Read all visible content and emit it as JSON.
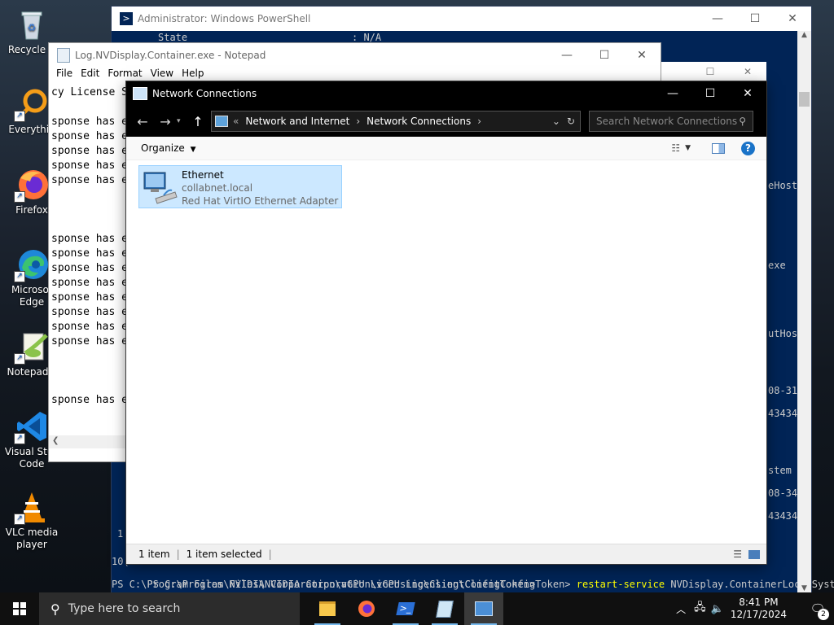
{
  "desktop": {
    "icons": [
      {
        "label": "Recycle Bin",
        "short": "Recycle B"
      },
      {
        "label": "Everything",
        "short": "Everythin"
      },
      {
        "label": "Firefox"
      },
      {
        "label": "Microsoft Edge",
        "line1": "Microsof",
        "line2": "Edge"
      },
      {
        "label": "Notepad++",
        "short": "Notepad+"
      },
      {
        "label": "Visual Studio Code",
        "line1": "Visual Stuc",
        "line2": "Code"
      },
      {
        "label": "VLC media player",
        "line1": "VLC media",
        "line2": "player"
      }
    ]
  },
  "powershell": {
    "title": "Administrator: Windows PowerShell",
    "state_label": "State",
    "state_value": ": N/A",
    "right_fragments": [
      "eHost.",
      "exe",
      "utHos",
      "08-31",
      "43434",
      "stem",
      "08-34",
      "43434"
    ],
    "left_fragments": [
      "1",
      "10("
    ],
    "cmd_prompt": "PS C:\\Program Files\\NVIDIA Corporation\\vGPU Licensing\\ClientConfigToken> ",
    "cmd_command": "restart-service",
    "cmd_arg": " NVDisplay.ContainerLocalSystem",
    "prompt2": "PS C:\\Program Files\\NVIDIA Corporation\\vGPU Licensing\\ClientConfigToken>"
  },
  "notepad": {
    "title": "Log.NVDisplay.Container.exe - Notepad",
    "menu": [
      "File",
      "Edit",
      "Format",
      "View",
      "Help"
    ],
    "lines": [
      "cy License S",
      "",
      "sponse has e",
      "sponse has e",
      "sponse has e",
      "sponse has e",
      "sponse has e",
      "",
      "",
      "",
      "sponse has e",
      "sponse has e",
      "sponse has e",
      "sponse has e",
      "sponse has e",
      "sponse has e",
      "sponse has e",
      "sponse has e",
      "",
      "",
      "",
      "sponse has e"
    ]
  },
  "netconn": {
    "title": "Network Connections",
    "breadcrumb": [
      "Network and Internet",
      "Network Connections"
    ],
    "search_placeholder": "Search Network Connections",
    "organize": "Organize",
    "item": {
      "name": "Ethernet",
      "network": "collabnet.local",
      "adapter": "Red Hat VirtIO Ethernet Adapter"
    },
    "status": {
      "count": "1 item",
      "selected": "1 item selected"
    }
  },
  "taskbar": {
    "search_placeholder": "Type here to search",
    "time": "8:41 PM",
    "date": "12/17/2024",
    "notifications": "2"
  }
}
